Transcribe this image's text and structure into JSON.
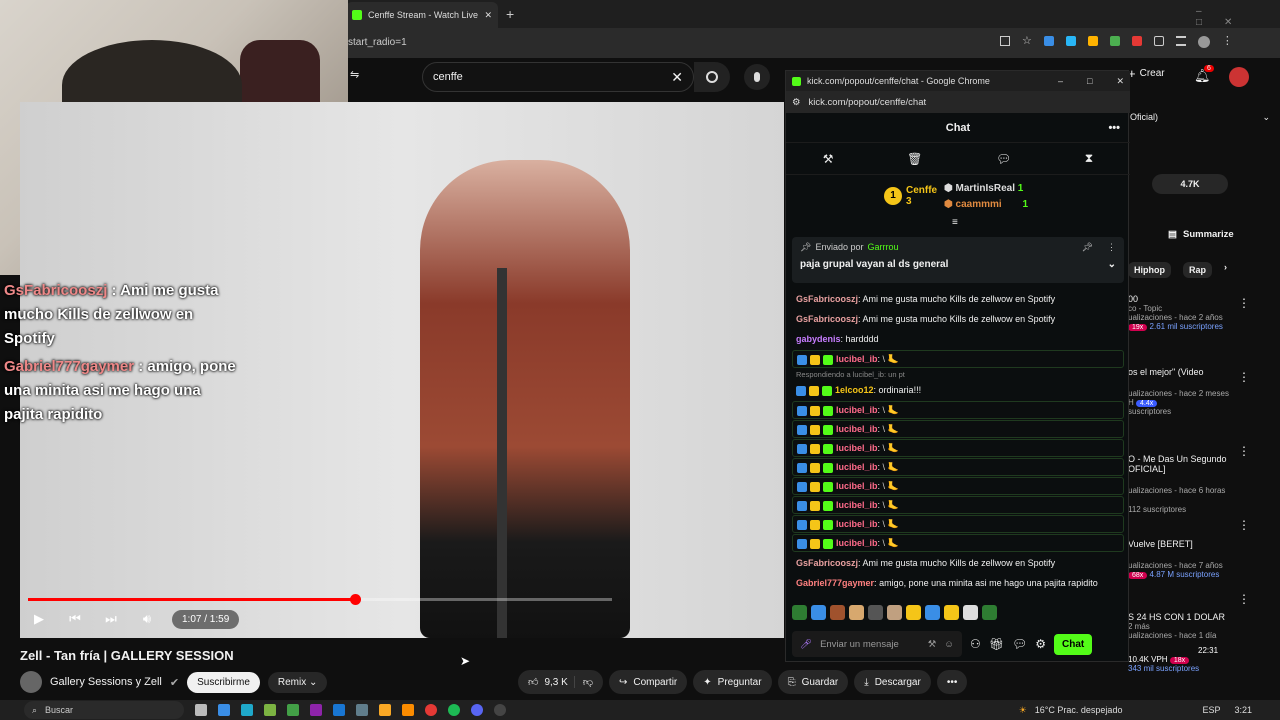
{
  "browser": {
    "tab_title": "Cenffe Stream - Watch Live",
    "url_fragment": "start_radio=1"
  },
  "youtube": {
    "search_value": "cenffe",
    "create_label": "Crear",
    "notif_count": "6",
    "video_title": "Zell - Tan fría | GALLERY SESSION",
    "channel": "Gallery Sessions y Zell",
    "subscribe": "Suscribirme",
    "remix": "Remix",
    "time": "1:07 / 1:59",
    "progress_fraction": 0.56,
    "likes": "9,3 K",
    "share": "Compartir",
    "ask": "Preguntar",
    "save": "Guardar",
    "download": "Descargar",
    "right": {
      "oficial": "Oficial)",
      "views_pill": "4.7K",
      "summarize": "Summarize",
      "chips": [
        "Hiphop",
        "Rap"
      ],
      "items": [
        {
          "title": "00",
          "line1": "co - Topic",
          "line2": "ualizaciones - hace 2 años",
          "badge": "19x",
          "subs": "2.61 mil suscriptores"
        },
        {
          "title": "os el mejor\" (Video",
          "line1": "",
          "line2": "ualizaciones - hace 2 meses",
          "badge": "4.4x",
          "prefix": "H",
          "subs": "suscriptores"
        },
        {
          "title": "O - Me Das Un Segundo",
          "title2": "OFICIAL]",
          "line2": "ualizaciones - hace 6 horas",
          "subs": "112 suscriptores"
        },
        {
          "title": "Vuelve [BERET]",
          "line2": "ualizaciones - hace 7 años",
          "badge": "68x",
          "subs": "4.87 M suscriptores"
        },
        {
          "title": "S 24 HS CON 1 DOLAR",
          "line1": "2 más",
          "line2": "ualizaciones - hace 1 día",
          "time": "22:31",
          "vph": "10.4K VPH",
          "badge": "18x",
          "subs": "343 mil suscriptores"
        }
      ]
    }
  },
  "overlay": [
    {
      "name": "GsFabricooszj",
      "text": " : Ami me gusta mucho Kills de zellwow en Spotify"
    },
    {
      "name": "Gabriel777gaymer",
      "text": " : amigo, pone una minita asi me hago una pajita rapidito"
    }
  ],
  "popup": {
    "window_title": "kick.com/popout/cenffe/chat - Google Chrome",
    "url": "kick.com/popout/cenffe/chat",
    "chat_header": "Chat",
    "leader": {
      "first": "Cenffe",
      "first_count": "3",
      "second": "MartinIsReal",
      "second_count": "1",
      "third": "caammmi",
      "third_count": "1"
    },
    "pinned": {
      "sent_by": "Enviado por",
      "sender": "Garrrou",
      "text": "paja grupal vayan al ds general"
    },
    "messages": [
      {
        "user": "GsFabricooszj",
        "color": "#e8a0a0",
        "text": "Ami me gusta mucho Kills de zellwow en Spotify",
        "boxed": false
      },
      {
        "user": "GsFabricooszj",
        "color": "#e8a0a0",
        "text": "Ami me gusta mucho Kills de zellwow en Spotify",
        "boxed": false
      },
      {
        "user": "gabydenis",
        "color": "#c77dff",
        "text": "hardddd",
        "boxed": false
      },
      {
        "user": "lucibel_ib",
        "color": "#ff6b8b",
        "text": "",
        "boxed": true
      },
      {
        "reply": "Respondiendo a lucibel_ib: un pt",
        "user": "1elcoo12",
        "color": "#f5c518",
        "text": "ordinaria!!!",
        "boxed": false
      },
      {
        "user": "lucibel_ib",
        "color": "#ff6b8b",
        "text": "",
        "boxed": true
      },
      {
        "user": "lucibel_ib",
        "color": "#ff6b8b",
        "text": "",
        "boxed": true
      },
      {
        "user": "lucibel_ib",
        "color": "#ff6b8b",
        "text": "",
        "boxed": true
      },
      {
        "user": "lucibel_ib",
        "color": "#ff6b8b",
        "text": "",
        "boxed": true
      },
      {
        "user": "lucibel_ib",
        "color": "#ff6b8b",
        "text": "",
        "boxed": true
      },
      {
        "user": "lucibel_ib",
        "color": "#ff6b8b",
        "text": "",
        "boxed": true
      },
      {
        "user": "lucibel_ib",
        "color": "#ff6b8b",
        "text": "",
        "boxed": true
      },
      {
        "user": "lucibel_ib",
        "color": "#ff6b8b",
        "text": "",
        "boxed": true
      },
      {
        "user": "GsFabricooszj",
        "color": "#e8a0a0",
        "text": "Ami me gusta mucho Kills de zellwow en Spotify",
        "boxed": false
      },
      {
        "user": "Gabriel777gaymer",
        "color": "#ff8080",
        "text": "amigo, pone una minita asi me hago una pajita rapidito",
        "boxed": false
      }
    ],
    "input_placeholder": "Enviar un mensaje",
    "send_label": "Chat",
    "accent": "#53fc18"
  },
  "taskbar": {
    "search": "Buscar",
    "weather": "16°C Prac. despejado",
    "lang": "ESP",
    "clock": "3:21"
  }
}
